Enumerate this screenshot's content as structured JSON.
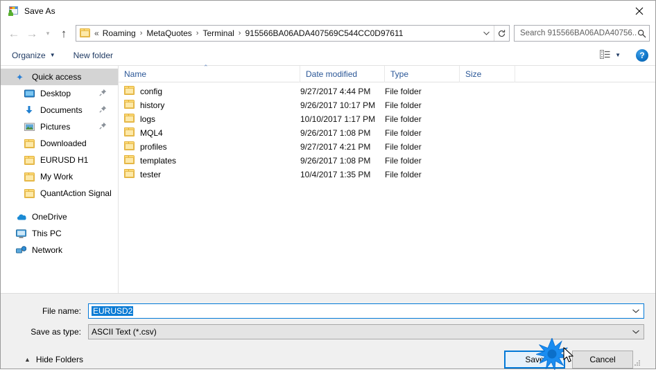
{
  "window": {
    "title": "Save As",
    "title_icon": "metatrader-app-icon",
    "close_icon": "close-icon"
  },
  "nav": {
    "back_icon": "back-arrow-icon",
    "forward_icon": "forward-arrow-icon",
    "recent_icon": "chevron-down-icon",
    "up_icon": "up-arrow-icon",
    "breadcrumb_prefix": "«",
    "breadcrumbs": [
      "Roaming",
      "MetaQuotes",
      "Terminal",
      "915566BA06ADA407569C544CC0D97611"
    ],
    "dropdown_icon": "chevron-down-icon",
    "refresh_icon": "refresh-icon"
  },
  "search": {
    "placeholder": "Search 915566BA06ADA40756...",
    "icon": "search-icon"
  },
  "toolbar": {
    "organize_label": "Organize",
    "organize_caret": "▼",
    "new_folder_label": "New folder",
    "view_icon": "view-layout-icon",
    "view_caret": "▼",
    "help_label": "?",
    "help_icon": "help-icon"
  },
  "sidebar": {
    "items": [
      {
        "label": "Quick access",
        "icon": "star-pin-icon",
        "selected": true,
        "indent": false,
        "pinned": false
      },
      {
        "label": "Desktop",
        "icon": "desktop-icon",
        "selected": false,
        "indent": true,
        "pinned": true
      },
      {
        "label": "Documents",
        "icon": "documents-icon",
        "selected": false,
        "indent": true,
        "pinned": true
      },
      {
        "label": "Pictures",
        "icon": "pictures-icon",
        "selected": false,
        "indent": true,
        "pinned": true
      },
      {
        "label": "Downloaded",
        "icon": "folder-icon",
        "selected": false,
        "indent": true,
        "pinned": false
      },
      {
        "label": "EURUSD H1",
        "icon": "folder-icon",
        "selected": false,
        "indent": true,
        "pinned": false
      },
      {
        "label": "My Work",
        "icon": "folder-icon",
        "selected": false,
        "indent": true,
        "pinned": false
      },
      {
        "label": "QuantAction Signal",
        "icon": "folder-icon",
        "selected": false,
        "indent": true,
        "pinned": false
      }
    ],
    "roots": [
      {
        "label": "OneDrive",
        "icon": "onedrive-cloud-icon"
      },
      {
        "label": "This PC",
        "icon": "this-pc-icon"
      },
      {
        "label": "Network",
        "icon": "network-icon"
      }
    ]
  },
  "filelist": {
    "columns": [
      "Name",
      "Date modified",
      "Type",
      "Size"
    ],
    "sort_column": "Name",
    "sort_caret": "⌃",
    "rows": [
      {
        "name": "config",
        "date": "9/27/2017 4:44 PM",
        "type": "File folder",
        "size": ""
      },
      {
        "name": "history",
        "date": "9/26/2017 10:17 PM",
        "type": "File folder",
        "size": ""
      },
      {
        "name": "logs",
        "date": "10/10/2017 1:17 PM",
        "type": "File folder",
        "size": ""
      },
      {
        "name": "MQL4",
        "date": "9/26/2017 1:08 PM",
        "type": "File folder",
        "size": ""
      },
      {
        "name": "profiles",
        "date": "9/27/2017 4:21 PM",
        "type": "File folder",
        "size": ""
      },
      {
        "name": "templates",
        "date": "9/26/2017 1:08 PM",
        "type": "File folder",
        "size": ""
      },
      {
        "name": "tester",
        "date": "10/4/2017 1:35 PM",
        "type": "File folder",
        "size": ""
      }
    ]
  },
  "form": {
    "filename_label": "File name:",
    "filename_value": "EURUSD2",
    "filetype_label": "Save as type:",
    "filetype_value": "ASCII Text (*.csv)"
  },
  "footer": {
    "hide_folders_label": "Hide Folders",
    "hide_folders_icon": "chevron-up-icon",
    "save_label": "Save",
    "cancel_label": "Cancel"
  },
  "colors": {
    "accent": "#0078d7",
    "selection": "#0c7cd5",
    "header_text": "#2b5797",
    "folder_yellow": "#fcd975",
    "footer_bg": "#f0f0f0",
    "sidebar_selected": "#d4d4d4"
  }
}
